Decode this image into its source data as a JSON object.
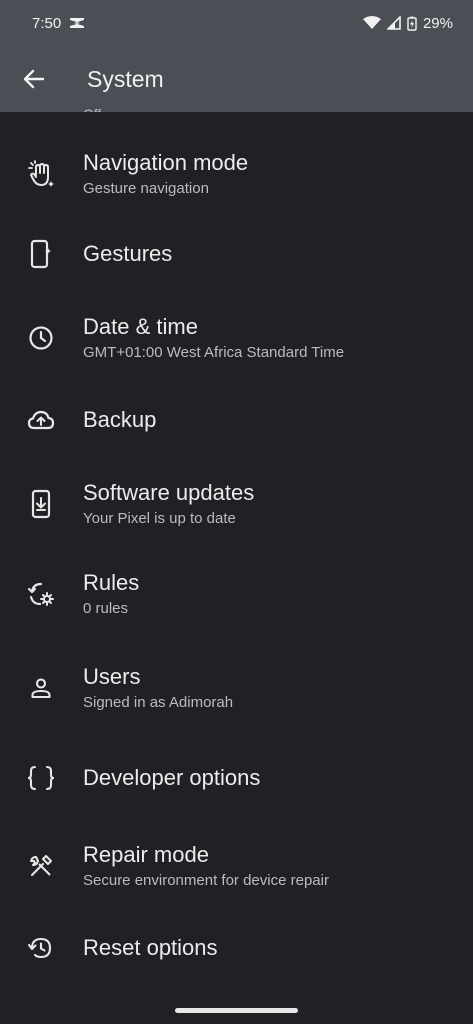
{
  "status_bar": {
    "time": "7:50",
    "battery": "29%"
  },
  "app_bar": {
    "title": "System"
  },
  "partial_above": "Off",
  "items": [
    {
      "label": "Navigation mode",
      "sub": "Gesture navigation",
      "icon": "gesture-hand-icon"
    },
    {
      "label": "Gestures",
      "sub": "",
      "icon": "phone-gesture-icon"
    },
    {
      "label": "Date & time",
      "sub": "GMT+01:00 West Africa Standard Time",
      "icon": "clock-icon"
    },
    {
      "label": "Backup",
      "sub": "",
      "icon": "cloud-upload-icon"
    },
    {
      "label": "Software updates",
      "sub": "Your Pixel is up to date",
      "icon": "system-update-icon"
    },
    {
      "label": "Rules",
      "sub": "0 rules",
      "icon": "rules-icon"
    },
    {
      "label": "Users",
      "sub": "Signed in as Adimorah",
      "icon": "person-icon"
    },
    {
      "label": "Developer options",
      "sub": "",
      "icon": "braces-icon"
    },
    {
      "label": "Repair mode",
      "sub": "Secure environment for device repair",
      "icon": "repair-tools-icon"
    },
    {
      "label": "Reset options",
      "sub": "",
      "icon": "history-icon"
    }
  ]
}
